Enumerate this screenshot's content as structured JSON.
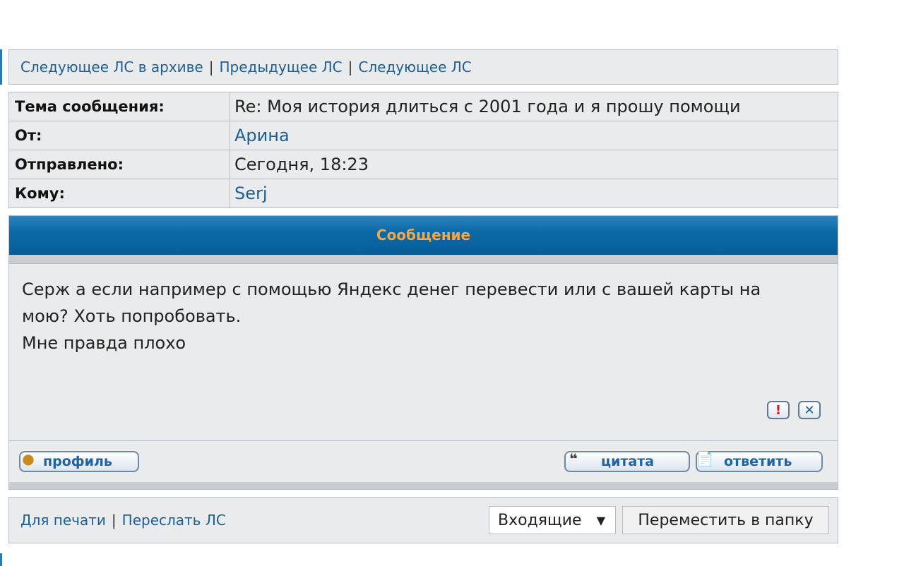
{
  "nav": {
    "next_archive": "Следующее ЛС в архиве",
    "separator": "|",
    "previous": "Предыдущее ЛС",
    "next": "Следующее ЛС"
  },
  "header": {
    "subject_label": "Тема сообщения:",
    "subject_value": "Re: Моя история длиться с 2001 года и я прошу помощи",
    "from_label": "От:",
    "from_value": "Арина",
    "sent_label": "Отправлено:",
    "sent_value": "Сегодня, 18:23",
    "to_label": "Кому:",
    "to_value": "Serj"
  },
  "message": {
    "title": "Сообщение",
    "lines": [
      "Серж а если например с помощью Яндекс денег перевести или с вашей карты на",
      "мою? Хоть попробовать.",
      "Мне правда плохо"
    ]
  },
  "buttons": {
    "profile": "профиль",
    "quote": "цитата",
    "reply": "ответить"
  },
  "footer": {
    "print": "Для печати",
    "forward": "Переслать ЛС",
    "folder_selected": "Входящие",
    "move_label": "Переместить в папку"
  },
  "colors": {
    "header_bar": "#0b6aa8",
    "header_text": "#f6a640",
    "link": "#1d5f95",
    "panel_bg": "#eaebec"
  },
  "icons": [
    "report-icon",
    "delete-icon",
    "profile-icon",
    "quote-icon",
    "reply-icon",
    "dropdown-arrow-icon"
  ]
}
